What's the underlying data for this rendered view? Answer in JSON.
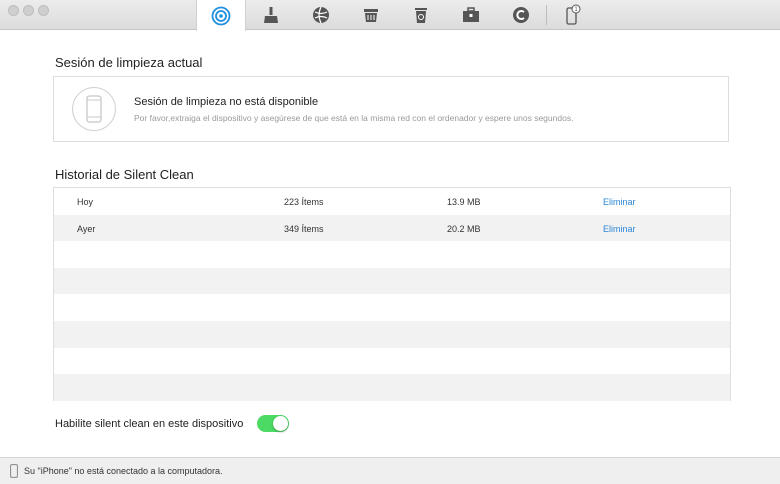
{
  "toolbar": {
    "items": [
      {
        "icon": "airdrop-icon",
        "active": true
      },
      {
        "icon": "broom-icon"
      },
      {
        "icon": "globe-icon"
      },
      {
        "icon": "basket-icon"
      },
      {
        "icon": "trash-icon"
      },
      {
        "icon": "toolbox-icon"
      },
      {
        "icon": "clean-icon"
      },
      {
        "icon": "device-icon"
      }
    ]
  },
  "current_session": {
    "title": "Sesión de limpieza actual",
    "status_title": "Sesión de limpieza no está disponible",
    "status_desc": "Por favor,extraiga el dispositivo y asegúrese de que está en la misma red con el ordenador y espere unos segundos."
  },
  "history": {
    "title": "Historial de Silent Clean",
    "rows": [
      {
        "day": "Hoy",
        "items": "223 Ítems",
        "size": "13.9 MB",
        "action": "Eliminar"
      },
      {
        "day": "Ayer",
        "items": "349 Ítems",
        "size": "20.2 MB",
        "action": "Eliminar"
      }
    ]
  },
  "settings": {
    "enable_label": "Habilite silent clean en este dispositivo",
    "enabled": true
  },
  "status_bar": {
    "text": "Su \"iPhone\" no está conectado a la computadora."
  },
  "colors": {
    "accent": "#2b86d6",
    "toggle_on": "#4cd964"
  }
}
